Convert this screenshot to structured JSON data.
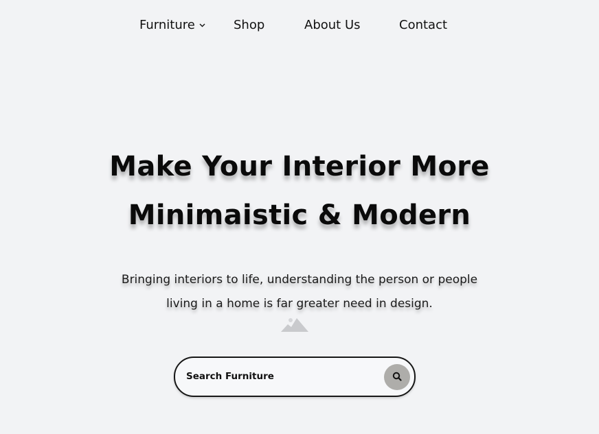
{
  "nav": {
    "items": [
      {
        "label": "Furniture",
        "has_dropdown": true
      },
      {
        "label": "Shop"
      },
      {
        "label": "About Us"
      },
      {
        "label": "Contact"
      }
    ]
  },
  "hero": {
    "title_line1": "Make Your Interior More",
    "title_line2": "Minimaistic & Modern",
    "subtitle_line1": "Bringing interiors to life, understanding the person or people",
    "subtitle_line2": "living in a home is far greater need in design."
  },
  "search": {
    "placeholder": "Search Furniture",
    "button_icon": "search-icon"
  },
  "placeholder_image_icon": "image-placeholder-icon",
  "colors": {
    "background": "#f2f3f5",
    "search_button": "#aeadaa",
    "text": "#111111"
  }
}
